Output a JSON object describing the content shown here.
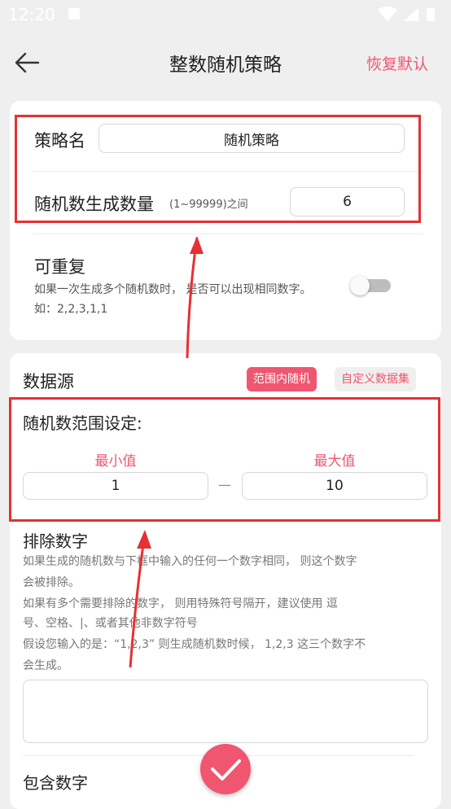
{
  "status_bar": {
    "time": "12:20"
  },
  "app_bar": {
    "title": "整数随机策略",
    "restore_label": "恢复默认"
  },
  "strategy": {
    "name_label": "策略名",
    "name_value": "随机策略",
    "count_label": "随机数生成数量",
    "count_hint": "(1~99999)之间",
    "count_value": "6"
  },
  "repeatable": {
    "title": "可重复",
    "desc_line1": "如果一次生成多个随机数时， 是否可以出现相同数字。",
    "desc_line2": "如：2,2,3,1,1",
    "enabled": false
  },
  "data_source": {
    "title": "数据源",
    "tabs": [
      {
        "label": "范围内随机",
        "active": true
      },
      {
        "label": "自定义数据集",
        "active": false
      }
    ]
  },
  "range": {
    "title": "随机数范围设定:",
    "min_label": "最小值",
    "max_label": "最大值",
    "min_value": "1",
    "max_value": "10",
    "separator": "—"
  },
  "exclude": {
    "title": "排除数字",
    "desc_lines": [
      "如果生成的随机数与下框中输入的任何一个数字相同， 则这个数字",
      "会被排除。",
      "如果有多个需要排除的数字， 则用特殊符号隔开，建议使用 逗",
      "号、空格、|、或者其他非数字符号",
      "假设您输入的是：“1,2,3” 则生成随机数时候， 1,2,3 这三个数字不",
      "会生成。"
    ],
    "input_value": ""
  },
  "include": {
    "title": "包含数字"
  },
  "colors": {
    "accent": "#f0566f",
    "annotation_red": "#e63033"
  }
}
